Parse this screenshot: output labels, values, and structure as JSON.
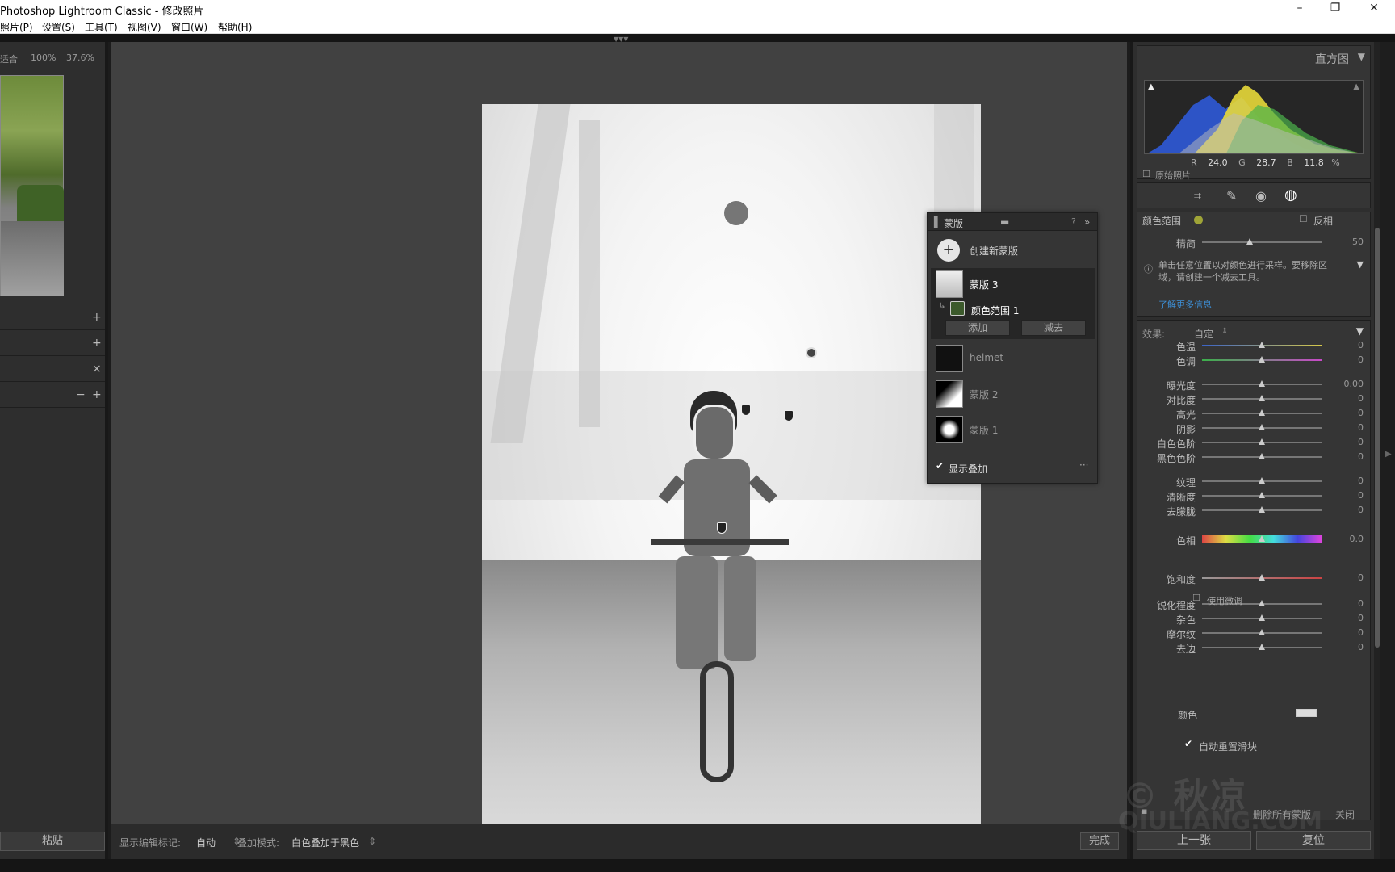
{
  "window": {
    "title": "Photoshop Lightroom Classic - 修改照片"
  },
  "menu": [
    "照片(P)",
    "设置(S)",
    "工具(T)",
    "视图(V)",
    "窗口(W)",
    "帮助(H)"
  ],
  "navigator": {
    "fit": "适合",
    "zoom1": "100%",
    "zoom2": "37.6%"
  },
  "left_panel": {
    "paste": "粘贴"
  },
  "toolbar": {
    "show_pins_label": "显示编辑标记:",
    "show_pins_value": "自动",
    "overlay_mode_label": "叠加模式:",
    "overlay_mode_value": "白色叠加于黑色",
    "done": "完成"
  },
  "mask_panel": {
    "title": "蒙版",
    "create_new": "创建新蒙版",
    "masks": [
      {
        "name": "蒙版 3",
        "selected": true
      },
      {
        "name": "helmet",
        "selected": false
      },
      {
        "name": "蒙版 2",
        "selected": false
      },
      {
        "name": "蒙版 1",
        "selected": false
      }
    ],
    "component": "颜色范围 1",
    "add": "添加",
    "subtract": "减去",
    "show_overlay": "显示叠加",
    "show_overlay_checked": true
  },
  "histogram": {
    "title": "直方图",
    "r_label": "R",
    "r": "24.0",
    "g_label": "G",
    "g": "28.7",
    "b_label": "B",
    "b": "11.8",
    "pct": "%",
    "original_photo": "原始照片"
  },
  "color_range": {
    "label": "颜色范围",
    "invert": "反相",
    "refine_label": "精简",
    "refine_value": "50",
    "refine_level": 0.5,
    "info": "单击任意位置以对颜色进行采样。要移除区域，请创建一个减去工具。",
    "learn_more": "了解更多信息"
  },
  "effects": {
    "label": "效果:",
    "preset": "自定",
    "sliders": [
      {
        "name": "色温",
        "value": "0"
      },
      {
        "name": "色调",
        "value": "0"
      },
      {
        "name": "曝光度",
        "value": "0.00"
      },
      {
        "name": "对比度",
        "value": "0"
      },
      {
        "name": "高光",
        "value": "0"
      },
      {
        "name": "阴影",
        "value": "0"
      },
      {
        "name": "白色色阶",
        "value": "0"
      },
      {
        "name": "黑色色阶",
        "value": "0"
      },
      {
        "name": "纹理",
        "value": "0"
      },
      {
        "name": "清晰度",
        "value": "0"
      },
      {
        "name": "去朦胧",
        "value": "0"
      },
      {
        "name": "色相",
        "value": "0.0"
      },
      {
        "name": "饱和度",
        "value": "0"
      },
      {
        "name": "锐化程度",
        "value": "0"
      },
      {
        "name": "杂色",
        "value": "0"
      },
      {
        "name": "摩尔纹",
        "value": "0"
      },
      {
        "name": "去边",
        "value": "0"
      }
    ],
    "fine_tune": "使用微调",
    "color_label": "颜色",
    "auto_reset": "自动重置滑块",
    "delete_all": "删除所有蒙版",
    "close": "关闭"
  },
  "nav_buttons": {
    "prev": "上一张",
    "reset": "复位"
  },
  "watermark": {
    "line1": "© 秋凉",
    "line2": "QIULIANG.COM"
  },
  "colors": {
    "accent_blue": "#3d8fd6",
    "panel": "#2e2e2e",
    "stage": "#414141"
  },
  "icons": [
    "minimize-icon",
    "maximize-icon",
    "close-icon",
    "crop-icon",
    "healing-icon",
    "redeye-icon",
    "mask-icon",
    "plus-icon",
    "info-icon",
    "eyedropper-icon"
  ]
}
